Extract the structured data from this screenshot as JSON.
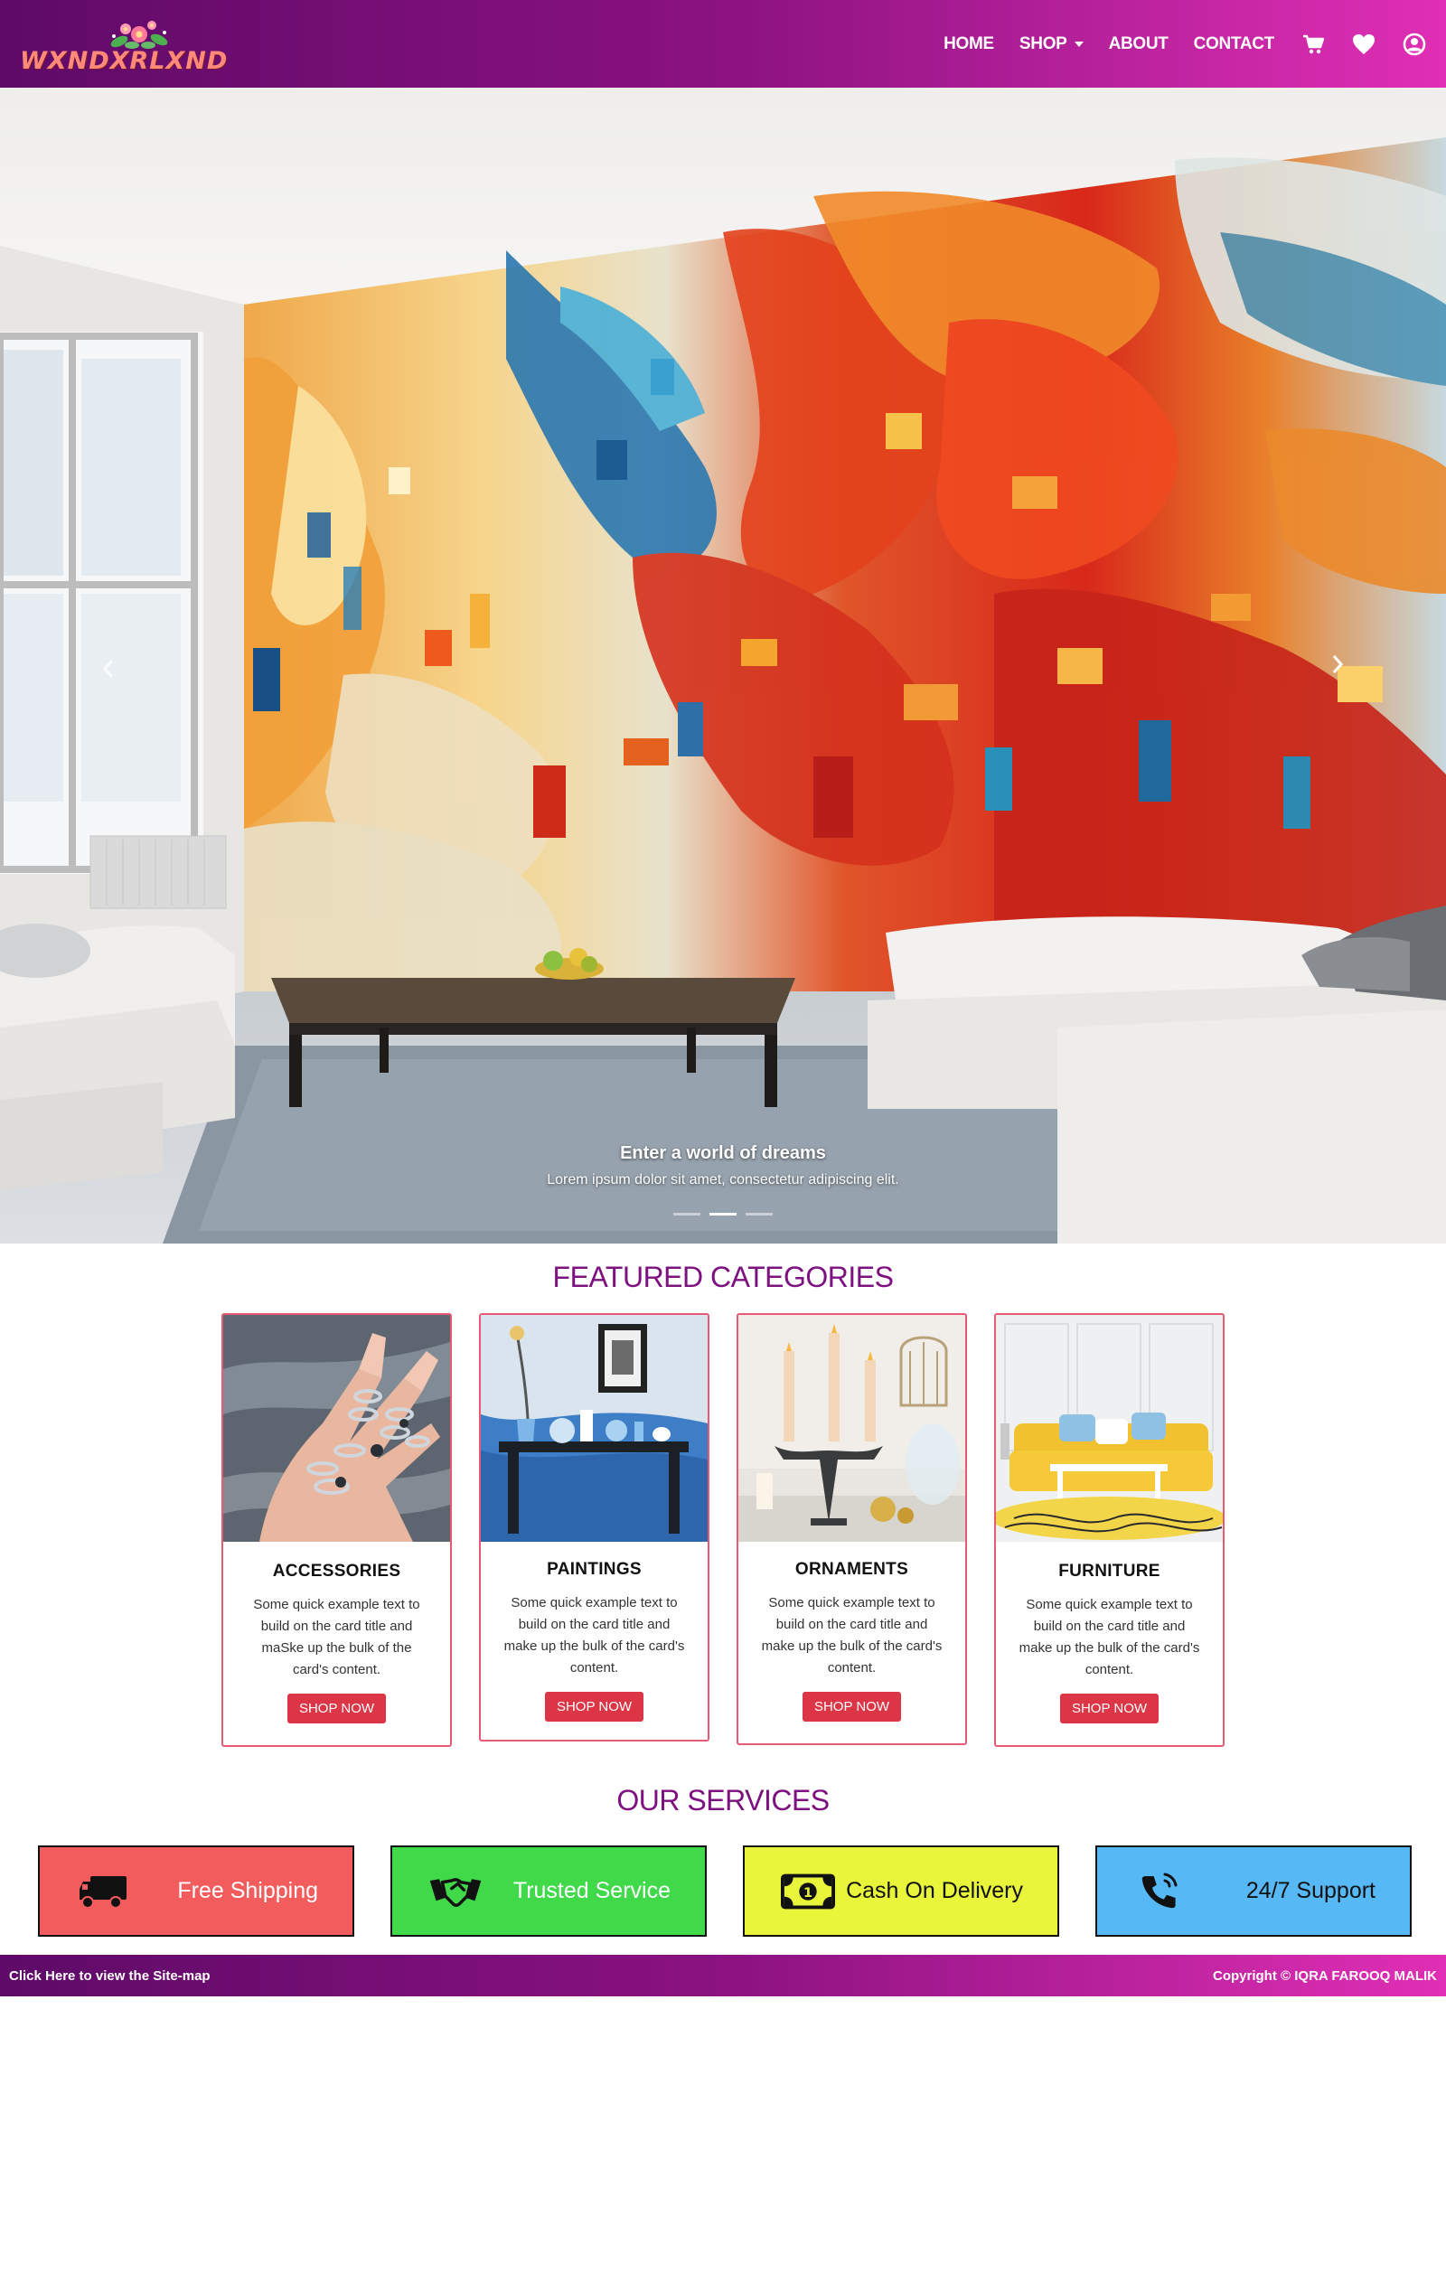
{
  "brand": {
    "logo_text": "WXNDXRLXND"
  },
  "nav": {
    "items": [
      {
        "label": "HOME"
      },
      {
        "label": "SHOP"
      },
      {
        "label": "ABOUT"
      },
      {
        "label": "CONTACT"
      }
    ],
    "icons": [
      "cart-icon",
      "heart-icon",
      "user-icon"
    ]
  },
  "hero": {
    "caption_title": "Enter a world of dreams",
    "caption_text": "Lorem ipsum dolor sit amet, consectetur adipiscing elit.",
    "slides_count": 3,
    "active_slide": 2
  },
  "featured": {
    "title": "FEATURED CATEGORIES",
    "cards": [
      {
        "title": "ACCESSORIES",
        "text": "Some quick example text to build on the card title and maSke up the bulk of the card's content.",
        "button": "SHOP NOW"
      },
      {
        "title": "PAINTINGS",
        "text": "Some quick example text to build on the card title and make up the bulk of the card's content.",
        "button": "SHOP NOW"
      },
      {
        "title": "ORNAMENTS",
        "text": "Some quick example text to build on the card title and make up the bulk of the card's content.",
        "button": "SHOP NOW"
      },
      {
        "title": "FURNITURE",
        "text": "Some quick example text to build on the card title and make up the bulk of the card's content.",
        "button": "SHOP NOW"
      }
    ]
  },
  "services": {
    "title": "OUR SERVICES",
    "items": [
      {
        "label": "Free Shipping",
        "icon": "truck-icon",
        "color": "#f25c5c"
      },
      {
        "label": "Trusted Service",
        "icon": "handshake-icon",
        "color": "#3fd94a"
      },
      {
        "label": "Cash On Delivery",
        "icon": "money-icon",
        "color": "#e8f53a"
      },
      {
        "label": "24/7 Support",
        "icon": "phone-icon",
        "color": "#56b8f5"
      }
    ]
  },
  "footer": {
    "sitemap_link": "Click Here to view the Site-map",
    "copyright": "Copyright © IQRA FAROOQ MALIK"
  },
  "colors": {
    "brand_purple": "#7d1180",
    "accent_pink": "#e02fb5",
    "button_red": "#dc3545"
  }
}
